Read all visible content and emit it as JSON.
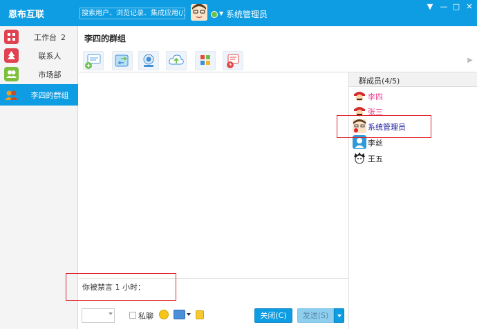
{
  "app": {
    "title": "恩布互联"
  },
  "search": {
    "placeholder": "搜索用户、浏览记录、集成应用(/)"
  },
  "user": {
    "name": "系统管理员",
    "status": "online",
    "status_color": "#6ac14a"
  },
  "window_controls": [
    "▼",
    "—",
    "□",
    "✕"
  ],
  "sidebar": {
    "items": [
      {
        "label": "工作台",
        "badge": "2",
        "icon": "workbench-icon",
        "color": "#e0434f"
      },
      {
        "label": "联系人",
        "icon": "contacts-tree-icon",
        "color": "#e0434f"
      },
      {
        "label": "市场部",
        "icon": "group-icon",
        "color": "#7cbf3b"
      },
      {
        "label": "李四的群组",
        "icon": "group-users-icon",
        "color": "#f59a23",
        "active": true
      }
    ]
  },
  "chat": {
    "title": "李四的群组"
  },
  "toolbar": {
    "buttons": [
      "new-chat-icon",
      "transfer-icon",
      "video-icon",
      "upload-icon",
      "apps-icon",
      "history-icon"
    ]
  },
  "members": {
    "title": "群成员(4/5)",
    "list": [
      {
        "name": "李四",
        "color": "#e83a8a"
      },
      {
        "name": "张三",
        "color": "#e83a8a"
      },
      {
        "name": "系统管理员",
        "color": "#1a1a9a"
      },
      {
        "name": "李丝",
        "color": "#222222"
      },
      {
        "name": "王五",
        "color": "#222222"
      }
    ]
  },
  "input": {
    "text": "你被禁言 1 小时："
  },
  "bottom": {
    "private_label": "私聊",
    "close_label": "关闭(C)",
    "send_label": "发送(S)"
  },
  "colors": {
    "accent": "#0e9de2",
    "highlight": "#e0202a"
  }
}
